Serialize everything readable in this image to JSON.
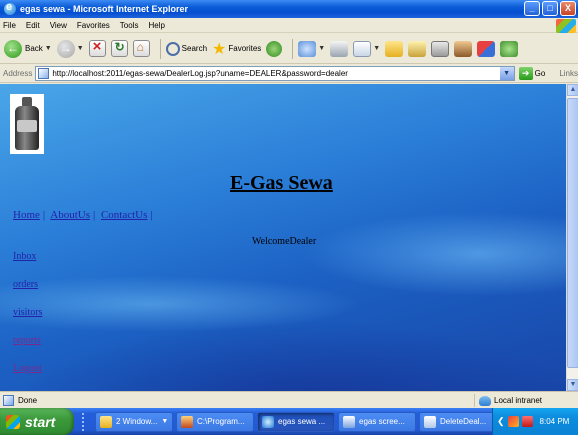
{
  "window": {
    "title": "egas sewa - Microsoft Internet Explorer",
    "buttons": [
      "_",
      "□",
      "X"
    ]
  },
  "menu": [
    "File",
    "Edit",
    "View",
    "Favorites",
    "Tools",
    "Help"
  ],
  "toolbar": {
    "back_label": "Back",
    "search_label": "Search",
    "favorites_label": "Favorites"
  },
  "address": {
    "label": "Address",
    "url": "http://localhost:2011/egas-sewa/DealerLog.jsp?uname=DEALER&password=dealer",
    "go_label": "Go",
    "links_label": "Links"
  },
  "page": {
    "heading": "E-Gas Sewa",
    "top_nav": [
      "Home",
      "AboutUs",
      "ContactUs"
    ],
    "welcome": "WelcomeDealer",
    "side_links": [
      "Inbox",
      "orders",
      "visitors",
      "reports",
      "Logout"
    ]
  },
  "status": {
    "text": "Done",
    "zone": "Local intranet"
  },
  "taskbar": {
    "start_label": "start",
    "tasks": [
      "2 Window...",
      "C:\\Program...",
      "egas sewa ...",
      "egas scree...",
      "DeleteDeal..."
    ],
    "clock": "8:04 PM"
  },
  "colors": {
    "title_bar": "#0a5ad8",
    "link": "#2222aa",
    "visited_link": "#7a2a8c",
    "page_bg": "#2b7fd8"
  }
}
